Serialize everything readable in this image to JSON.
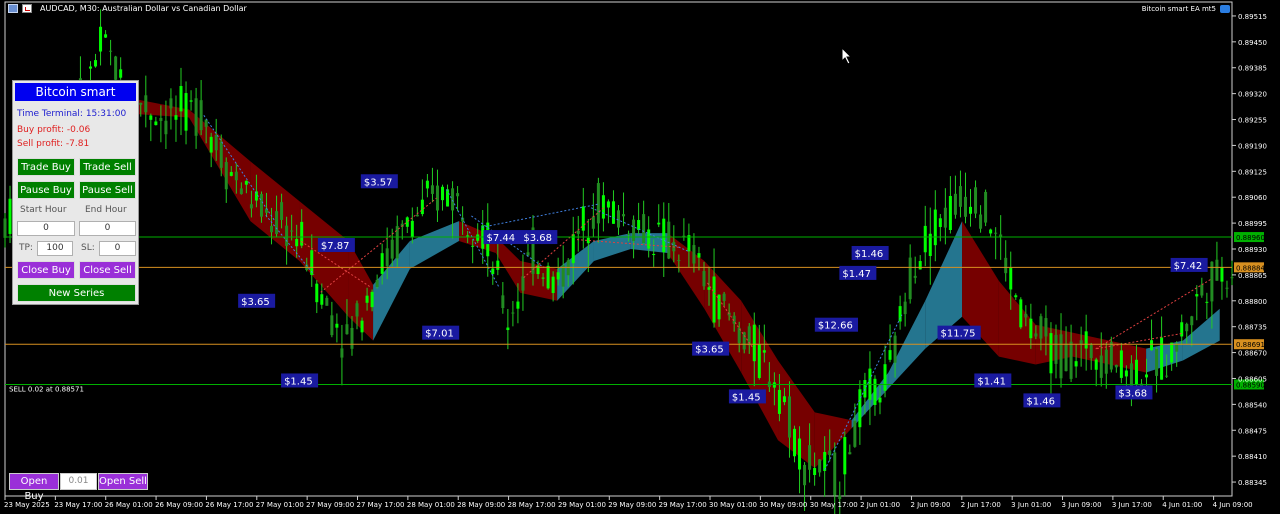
{
  "header": {
    "symbol_title": "AUDCAD, M30:",
    "symbol_desc": "Australian Dollar vs Canadian Dollar",
    "ea_name": "Bitcoin smart EA mt5"
  },
  "panel": {
    "title": "Bitcoin smart",
    "time_terminal": "Time Terminal: 15:31:00",
    "buy_profit": "Buy profit: -0.06",
    "sell_profit": "Sell profit: -7.81",
    "trade_buy": "Trade Buy",
    "trade_sell": "Trade Sell",
    "pause_buy": "Pause Buy",
    "pause_sell": "Pause Sell",
    "start_hour_label": "Start Hour",
    "end_hour_label": "End Hour",
    "start_hour_value": "0",
    "end_hour_value": "0",
    "tp_label": "TP:",
    "tp_value": "100",
    "sl_label": "SL:",
    "sl_value": "0",
    "close_buy": "Close Buy",
    "close_sell": "Close Sell",
    "new_series": "New Series"
  },
  "bottom": {
    "open_buy": "Open Buy",
    "lot_value": "0.01",
    "open_sell": "Open Sell"
  },
  "colors": {
    "background": "#000000",
    "bull_candle": "#22cc22",
    "bear_candle": "#22cc22",
    "cloud_bull": "#2a8aa8",
    "cloud_bear": "#8b0000",
    "green_line": "#00b000",
    "orange_line": "#d89020",
    "label_bg": "#1a1aa0",
    "panel_title": "#0000f0",
    "button_green": "#008000",
    "button_purple": "#9a2fd8"
  },
  "chart_data": {
    "type": "line",
    "series_label": "AUDCAD, M30",
    "price_axis": [
      "0.89515",
      "0.89450",
      "0.89385",
      "0.89320",
      "0.89255",
      "0.89190",
      "0.89125",
      "0.89060",
      "0.88995",
      "0.88930",
      "0.88865",
      "0.88800",
      "0.88735",
      "0.88670",
      "0.88605",
      "0.88540",
      "0.88475",
      "0.88410",
      "0.88345"
    ],
    "price_range": [
      0.8831,
      0.8955
    ],
    "time_axis": [
      "23 May 2025",
      "23 May 17:00",
      "26 May 01:00",
      "26 May 09:00",
      "26 May 17:00",
      "27 May 01:00",
      "27 May 09:00",
      "27 May 17:00",
      "28 May 01:00",
      "28 May 09:00",
      "28 May 17:00",
      "29 May 01:00",
      "29 May 09:00",
      "29 May 17:00",
      "30 May 01:00",
      "30 May 09:00",
      "30 May 17:00",
      "2 Jun 01:00",
      "2 Jun 09:00",
      "2 Jun 17:00",
      "3 Jun 01:00",
      "3 Jun 09:00",
      "3 Jun 17:00",
      "4 Jun 01:00",
      "4 Jun 09:00"
    ],
    "price_path": [
      [
        0,
        0.89
      ],
      [
        0.02,
        0.8907
      ],
      [
        0.05,
        0.892
      ],
      [
        0.08,
        0.8945
      ],
      [
        0.1,
        0.8932
      ],
      [
        0.13,
        0.8926
      ],
      [
        0.16,
        0.8928
      ],
      [
        0.18,
        0.8914
      ],
      [
        0.21,
        0.8902
      ],
      [
        0.24,
        0.8896
      ],
      [
        0.26,
        0.888
      ],
      [
        0.28,
        0.887
      ],
      [
        0.3,
        0.8885
      ],
      [
        0.33,
        0.89
      ],
      [
        0.36,
        0.8908
      ],
      [
        0.39,
        0.8898
      ],
      [
        0.41,
        0.8875
      ],
      [
        0.43,
        0.8892
      ],
      [
        0.45,
        0.8884
      ],
      [
        0.48,
        0.8905
      ],
      [
        0.51,
        0.89
      ],
      [
        0.53,
        0.8896
      ],
      [
        0.56,
        0.8892
      ],
      [
        0.58,
        0.888
      ],
      [
        0.6,
        0.8872
      ],
      [
        0.63,
        0.886
      ],
      [
        0.65,
        0.884
      ],
      [
        0.68,
        0.8836
      ],
      [
        0.7,
        0.8855
      ],
      [
        0.72,
        0.886
      ],
      [
        0.74,
        0.889
      ],
      [
        0.76,
        0.89
      ],
      [
        0.79,
        0.8908
      ],
      [
        0.81,
        0.8895
      ],
      [
        0.83,
        0.8875
      ],
      [
        0.86,
        0.8866
      ],
      [
        0.89,
        0.8868
      ],
      [
        0.92,
        0.8862
      ],
      [
        0.95,
        0.8866
      ],
      [
        0.98,
        0.8885
      ],
      [
        1.0,
        0.8888
      ]
    ],
    "cloud_top": [
      [
        0.1,
        0.8931
      ],
      [
        0.15,
        0.8928
      ],
      [
        0.2,
        0.8915
      ],
      [
        0.24,
        0.8905
      ],
      [
        0.28,
        0.8895
      ],
      [
        0.3,
        0.8884
      ],
      [
        0.33,
        0.8895
      ],
      [
        0.37,
        0.89
      ],
      [
        0.4,
        0.8896
      ],
      [
        0.42,
        0.889
      ],
      [
        0.45,
        0.8888
      ],
      [
        0.48,
        0.8895
      ],
      [
        0.51,
        0.8897
      ],
      [
        0.54,
        0.8897
      ],
      [
        0.57,
        0.889
      ],
      [
        0.6,
        0.888
      ],
      [
        0.63,
        0.8865
      ],
      [
        0.66,
        0.8852
      ],
      [
        0.69,
        0.885
      ],
      [
        0.72,
        0.8862
      ],
      [
        0.75,
        0.888
      ],
      [
        0.78,
        0.89
      ],
      [
        0.81,
        0.8885
      ],
      [
        0.84,
        0.8874
      ],
      [
        0.87,
        0.8872
      ],
      [
        0.9,
        0.887
      ],
      [
        0.93,
        0.8868
      ],
      [
        0.96,
        0.887
      ],
      [
        0.99,
        0.8878
      ]
    ],
    "cloud_bottom": [
      [
        0.1,
        0.8927
      ],
      [
        0.15,
        0.8926
      ],
      [
        0.2,
        0.89
      ],
      [
        0.24,
        0.889
      ],
      [
        0.28,
        0.8876
      ],
      [
        0.3,
        0.887
      ],
      [
        0.33,
        0.8888
      ],
      [
        0.37,
        0.8895
      ],
      [
        0.4,
        0.8892
      ],
      [
        0.42,
        0.8882
      ],
      [
        0.45,
        0.888
      ],
      [
        0.48,
        0.889
      ],
      [
        0.51,
        0.8893
      ],
      [
        0.54,
        0.8892
      ],
      [
        0.57,
        0.8878
      ],
      [
        0.6,
        0.8862
      ],
      [
        0.63,
        0.8845
      ],
      [
        0.66,
        0.8838
      ],
      [
        0.69,
        0.8848
      ],
      [
        0.72,
        0.8858
      ],
      [
        0.75,
        0.8868
      ],
      [
        0.78,
        0.8876
      ],
      [
        0.81,
        0.8866
      ],
      [
        0.84,
        0.8864
      ],
      [
        0.87,
        0.8866
      ],
      [
        0.9,
        0.8864
      ],
      [
        0.93,
        0.8862
      ],
      [
        0.96,
        0.8865
      ],
      [
        0.99,
        0.887
      ]
    ],
    "hlines": [
      {
        "price": 0.8896,
        "color": "#00b000",
        "label": "0.88960"
      },
      {
        "price": 0.88884,
        "color": "#d89020",
        "label": "0.88884"
      },
      {
        "price": 0.88691,
        "color": "#d89020",
        "label": "0.88691"
      },
      {
        "price": 0.8859,
        "color": "#00b000",
        "label": "0.88590",
        "text": "SELL 0.02 at 0.88571"
      }
    ],
    "profit_labels": [
      {
        "text": "$3.57",
        "t": 0.29,
        "p": 0.891
      },
      {
        "text": "$7.87",
        "t": 0.255,
        "p": 0.8894
      },
      {
        "text": "$7.44",
        "t": 0.39,
        "p": 0.8896
      },
      {
        "text": "$3.68",
        "t": 0.42,
        "p": 0.8896
      },
      {
        "text": "$3.65",
        "t": 0.19,
        "p": 0.888
      },
      {
        "text": "$7.01",
        "t": 0.34,
        "p": 0.8872
      },
      {
        "text": "$1.45",
        "t": 0.225,
        "p": 0.886
      },
      {
        "text": "$3.65",
        "t": 0.56,
        "p": 0.8868
      },
      {
        "text": "$1.45",
        "t": 0.59,
        "p": 0.8856
      },
      {
        "text": "$12.66",
        "t": 0.66,
        "p": 0.8874
      },
      {
        "text": "$1.46",
        "t": 0.69,
        "p": 0.8892
      },
      {
        "text": "$1.47",
        "t": 0.68,
        "p": 0.8887
      },
      {
        "text": "$11.75",
        "t": 0.76,
        "p": 0.8872
      },
      {
        "text": "$1.41",
        "t": 0.79,
        "p": 0.886
      },
      {
        "text": "$1.46",
        "t": 0.83,
        "p": 0.8855
      },
      {
        "text": "$3.68",
        "t": 0.905,
        "p": 0.8857
      },
      {
        "text": "$7.42",
        "t": 0.95,
        "p": 0.8889
      }
    ],
    "grid": false,
    "legend": "none"
  }
}
